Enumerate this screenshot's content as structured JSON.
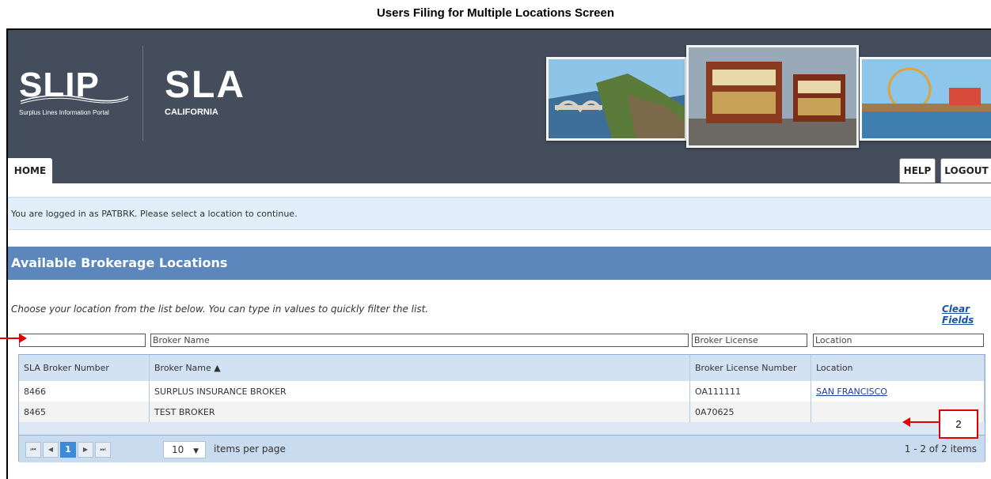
{
  "doc_title": "Users Filing for Multiple Locations Screen",
  "header": {
    "slip_logo": {
      "title": "SLIP",
      "tagline": "Surplus Lines Information Portal"
    },
    "sla_logo": {
      "title": "SLA",
      "tagline": "CALIFORNIA"
    },
    "photos": [
      "bixby-bridge-coast",
      "cable-cars",
      "santa-monica-pier"
    ]
  },
  "nav": {
    "home": "HOME",
    "help": "HELP",
    "logout": "LOGOUT"
  },
  "login_message": "You are logged in as PATBRK. Please select a location to continue.",
  "section_title": "Available Brokerage Locations",
  "instructions": "Choose your location from the list below. You can type in values to quickly filter the list.",
  "clear_fields": "Clear Fields",
  "filters": {
    "sla_number": "",
    "broker_name": "Broker Name",
    "broker_license": "Broker License",
    "location": "Location"
  },
  "grid": {
    "columns": [
      "SLA Broker Number",
      "Broker Name ▲",
      "Broker License Number",
      "Location"
    ],
    "rows": [
      {
        "sla": "8466",
        "name": "SURPLUS INSURANCE BROKER",
        "license": "OA111111",
        "location": "SAN FRANCISCO"
      },
      {
        "sla": "8465",
        "name": "TEST BROKER",
        "license": "0A70625",
        "location": ""
      }
    ],
    "pager": {
      "first": "⏮",
      "prev": "◀",
      "current_page": "1",
      "next": "▶",
      "last": "⏭",
      "page_size": "10",
      "page_size_arrow": "▼",
      "per_page_label": "items per page",
      "range_label": "1 - 2 of 2 items"
    }
  },
  "callout": {
    "label": "2"
  },
  "colors": {
    "header_bg": "#444d5b",
    "section_bar": "#5b87bd",
    "annotation_red": "#e00000",
    "link": "#1a3ca5"
  }
}
